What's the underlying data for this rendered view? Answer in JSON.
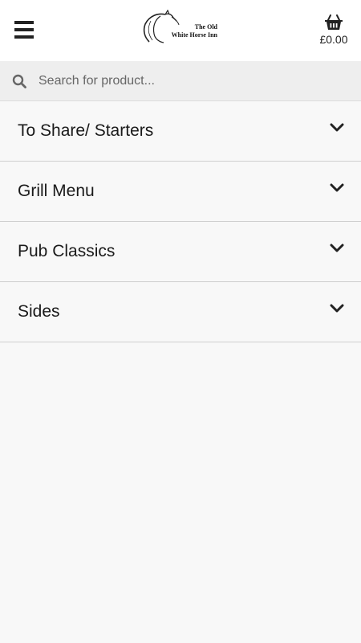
{
  "header": {
    "logo": {
      "line1": "The Old",
      "line2": "White Horse Inn",
      "icon": "horse-head-logo"
    },
    "menu_icon": "hamburger-menu-icon",
    "basket": {
      "icon": "basket-icon",
      "total": "£0.00"
    }
  },
  "search": {
    "icon": "search-icon",
    "placeholder": "Search for product...",
    "value": ""
  },
  "categories": [
    {
      "label": "To Share/ Starters",
      "icon": "chevron-down-icon"
    },
    {
      "label": "Grill Menu",
      "icon": "chevron-down-icon"
    },
    {
      "label": "Pub Classics",
      "icon": "chevron-down-icon"
    },
    {
      "label": "Sides",
      "icon": "chevron-down-icon"
    }
  ],
  "colors": {
    "header_bg": "#ffffff",
    "page_bg": "#f8f8f8",
    "search_bg": "#eeeeee",
    "divider": "#cfcfcf",
    "text": "#1a1a1a"
  }
}
